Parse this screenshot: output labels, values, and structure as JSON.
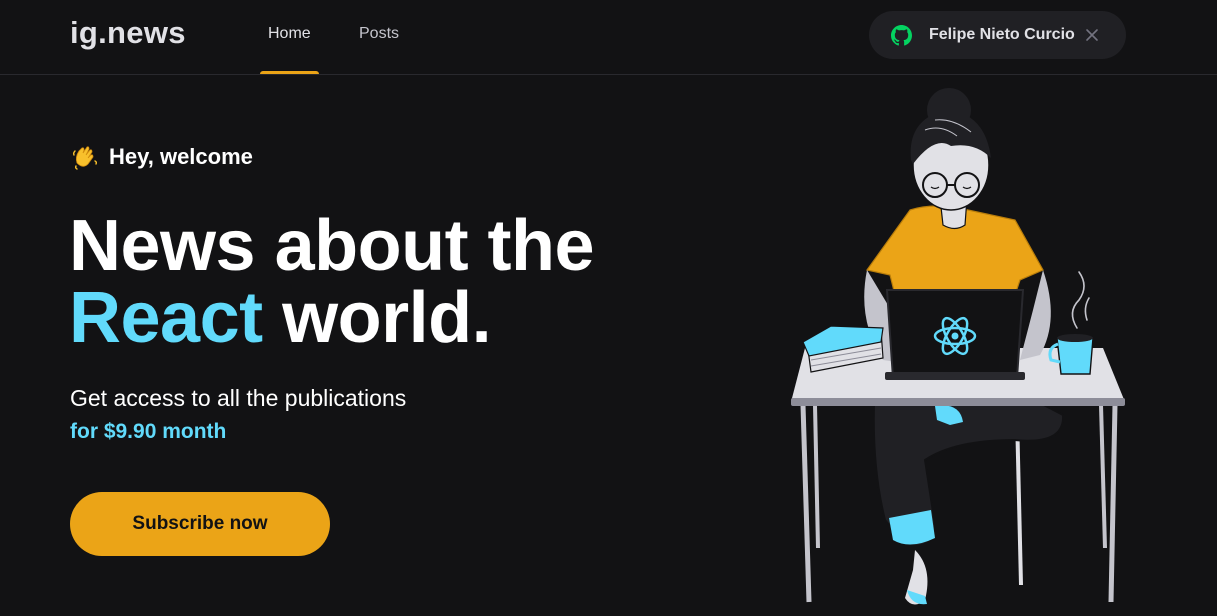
{
  "header": {
    "logo": "ig.news",
    "nav": [
      {
        "label": "Home",
        "active": true
      },
      {
        "label": "Posts",
        "active": false
      }
    ],
    "user": {
      "name": "Felipe Nieto Curcio",
      "provider_icon": "github-icon",
      "provider_icon_color": "#04d361",
      "close_icon": "close-icon"
    }
  },
  "hero": {
    "welcome_emoji": "clapping-hands-icon",
    "welcome_text": "Hey, welcome",
    "headline_line1": "News about the",
    "headline_accent": "React",
    "headline_rest": " world.",
    "subtext": "Get access to all the publications",
    "price": "for $9.90 month",
    "cta_label": "Subscribe now"
  },
  "colors": {
    "background": "#121214",
    "accent_yellow": "#eba417",
    "accent_cyan": "#61dafb",
    "header_border": "#29292e",
    "user_button_bg": "#202024"
  },
  "illustration": {
    "name": "woman-at-laptop-illustration",
    "laptop_logo": "react-logo-icon"
  }
}
